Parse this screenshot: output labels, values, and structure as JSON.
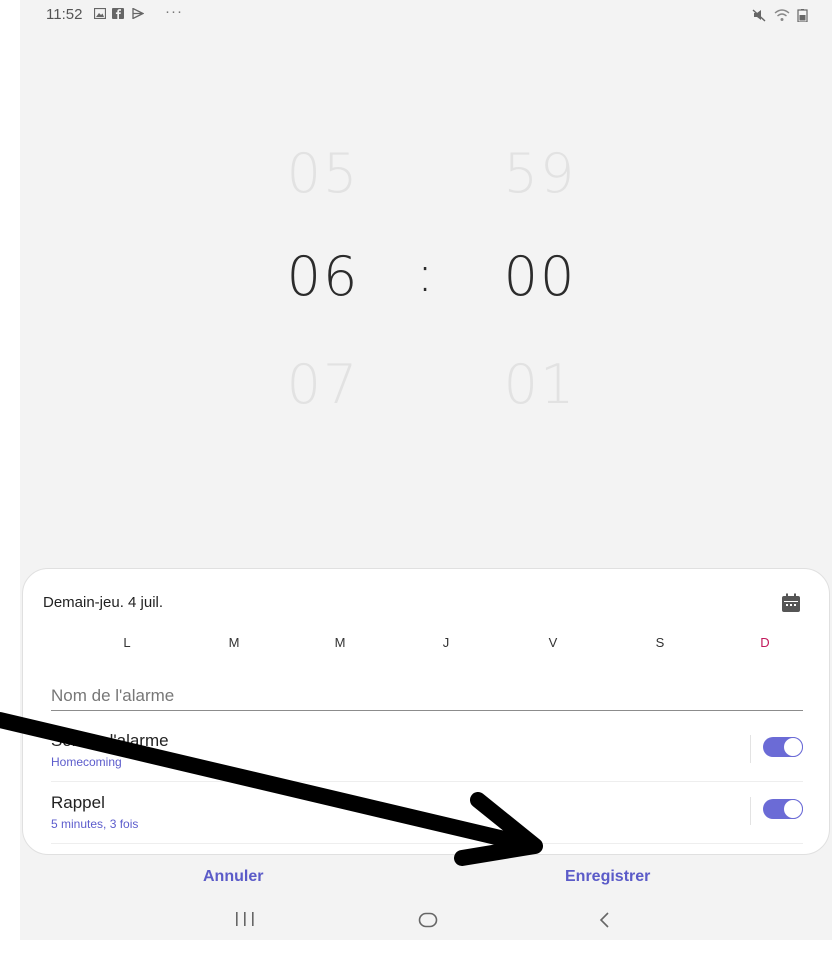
{
  "status_bar": {
    "time": "11:52",
    "more": "···"
  },
  "time_picker": {
    "hour_prev": "05",
    "hour": "06",
    "hour_next": "07",
    "separator": ":",
    "minute_prev": "59",
    "minute": "00",
    "minute_next": "01"
  },
  "alarm_settings": {
    "date_label": "Demain-jeu. 4 juil.",
    "days": [
      "L",
      "M",
      "M",
      "J",
      "V",
      "S",
      "D"
    ],
    "name_placeholder": "Nom de l'alarme",
    "sound": {
      "title": "Son de l'alarme",
      "subtitle": "Homecoming",
      "enabled": true
    },
    "snooze": {
      "title": "Rappel",
      "subtitle": "5 minutes, 3 fois",
      "enabled": true
    }
  },
  "actions": {
    "cancel": "Annuler",
    "save": "Enregistrer"
  },
  "colors": {
    "accent": "#5b5bc8",
    "toggle_on": "#6b6bd6",
    "sunday": "#c2185b",
    "background": "#f3f3f3"
  }
}
